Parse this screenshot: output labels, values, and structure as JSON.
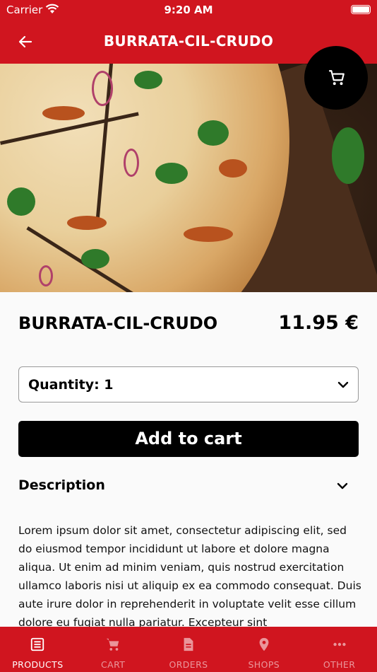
{
  "status_bar": {
    "carrier": "Carrier",
    "time": "9:20 AM"
  },
  "header": {
    "title": "BURRATA-CIL-CRUDO"
  },
  "product": {
    "name": "BURRATA-CIL-CRUDO",
    "price": "11.95 €",
    "quantity_label": "Quantity: 1",
    "add_to_cart_label": "Add to cart",
    "description_title": "Description",
    "description_text": "Lorem ipsum dolor sit amet, consectetur adipiscing elit, sed do eiusmod tempor incididunt ut labore et dolore magna aliqua. Ut enim ad minim veniam, quis nostrud exercitation ullamco laboris nisi ut aliquip ex ea commodo consequat. Duis aute irure dolor in reprehenderit in voluptate velit esse cillum dolore eu fugiat nulla pariatur. Excepteur sint"
  },
  "tabs": [
    {
      "label": "PRODUCTS",
      "icon": "list-icon",
      "active": true
    },
    {
      "label": "CART",
      "icon": "cart-icon",
      "active": false
    },
    {
      "label": "ORDERS",
      "icon": "document-icon",
      "active": false
    },
    {
      "label": "SHOPS",
      "icon": "location-pin-icon",
      "active": false
    },
    {
      "label": "OTHER",
      "icon": "more-dots-icon",
      "active": false
    }
  ],
  "colors": {
    "brand_red": "#d0151f",
    "button_black": "#000000"
  }
}
